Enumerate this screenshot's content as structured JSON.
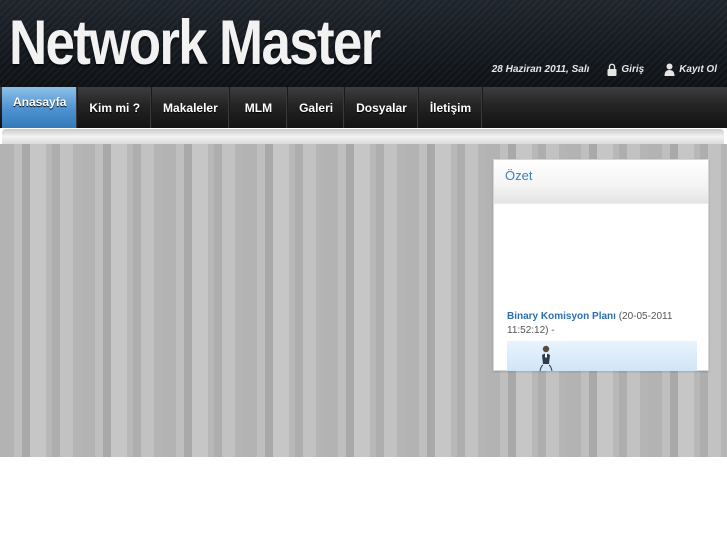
{
  "header": {
    "logo_text": "Network Master",
    "date": "28 Haziran 2011, Salı",
    "login_label": "Giriş",
    "login_icon": "lock-icon",
    "register_label": "Kayıt Ol",
    "register_icon": "user-icon"
  },
  "nav": {
    "items": [
      {
        "label": "Anasayfa",
        "active": true
      },
      {
        "label": "Kim mi ?"
      },
      {
        "label": "Makaleler"
      },
      {
        "label": "MLM"
      },
      {
        "label": "Galeri"
      },
      {
        "label": "Dosyalar"
      },
      {
        "label": "İletişim"
      }
    ]
  },
  "sidebar": {
    "panel_title": "Özet",
    "article_link": "Binary Komisyon Planı",
    "article_meta": " (20-05-2011 11:52:12) -",
    "thumbnail_icon": "person-icon"
  },
  "colors": {
    "accent_blue": "#4d92d0",
    "link_blue": "#2d6fae",
    "header_dark": "#14191f"
  }
}
